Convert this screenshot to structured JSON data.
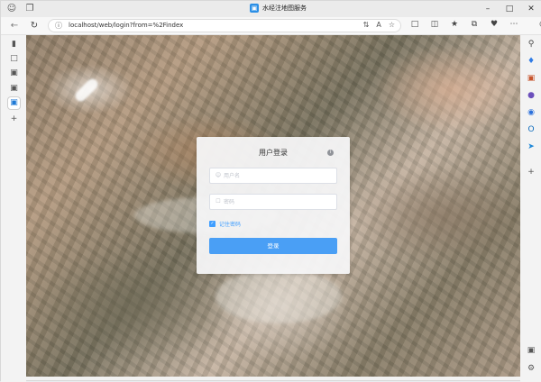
{
  "browser": {
    "tab_title": "水经注地图服务",
    "url": "localhost/web/login?from=%2Findex",
    "colors": {
      "accent": "#409eff",
      "favicon": "#2b8fe6"
    }
  },
  "login": {
    "title": "用户登录",
    "username_placeholder": "用户名",
    "password_placeholder": "密码",
    "remember_label": "记住密码",
    "remember_checked": true,
    "submit_label": "登录"
  }
}
